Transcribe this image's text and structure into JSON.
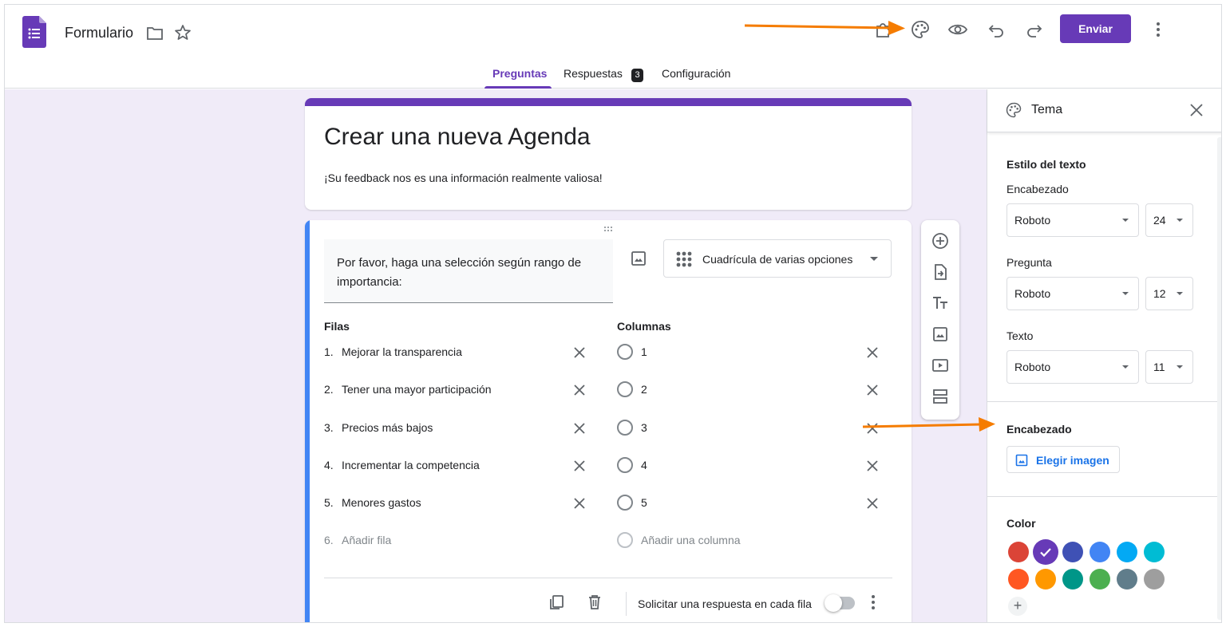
{
  "header": {
    "doc_title": "Formulario",
    "send_label": "Enviar",
    "tabs": [
      {
        "label": "Preguntas"
      },
      {
        "label": "Respuestas",
        "badge": "3"
      },
      {
        "label": "Configuración"
      }
    ]
  },
  "form": {
    "title": "Crear una nueva Agenda",
    "description": "¡Su feedback nos es una información realmente valiosa!"
  },
  "question": {
    "text": "Por favor, haga una selección según rango de importancia:",
    "type": "Cuadrícula de varias opciones",
    "rows_header": "Filas",
    "columns_header": "Columnas",
    "rows": [
      {
        "num": "1.",
        "label": "Mejorar la transparencia"
      },
      {
        "num": "2.",
        "label": "Tener una mayor participación"
      },
      {
        "num": "3.",
        "label": "Precios más bajos"
      },
      {
        "num": "4.",
        "label": "Incrementar la competencia"
      },
      {
        "num": "5.",
        "label": "Menores gastos"
      },
      {
        "num": "6.",
        "label": "Añadir fila"
      }
    ],
    "columns": [
      {
        "label": "1"
      },
      {
        "label": "2"
      },
      {
        "label": "3"
      },
      {
        "label": "4"
      },
      {
        "label": "5"
      },
      {
        "label": "Añadir una columna"
      }
    ],
    "required_label": "Solicitar una respuesta en cada fila"
  },
  "theme_panel": {
    "title": "Tema",
    "text_style_title": "Estilo del texto",
    "fields": [
      {
        "label": "Encabezado",
        "font": "Roboto",
        "size": "24"
      },
      {
        "label": "Pregunta",
        "font": "Roboto",
        "size": "12"
      },
      {
        "label": "Texto",
        "font": "Roboto",
        "size": "11"
      }
    ],
    "header_section_title": "Encabezado",
    "choose_image_label": "Elegir imagen",
    "color_title": "Color",
    "add_color": "+",
    "colors": {
      "row1": [
        "#db4437",
        "#673ab7",
        "#3f51b5",
        "#4285f4",
        "#03a9f4",
        "#00bcd4"
      ],
      "row2": [
        "#ff5722",
        "#ff9800",
        "#009688",
        "#4caf50",
        "#607d8b",
        "#9e9e9e"
      ],
      "selected": "#673ab7"
    }
  },
  "colors": {
    "accent": "#673ab7",
    "question_accent": "#4285f4",
    "canvas_bg": "#f0ebf8",
    "annotation_arrow": "#f57c00"
  }
}
